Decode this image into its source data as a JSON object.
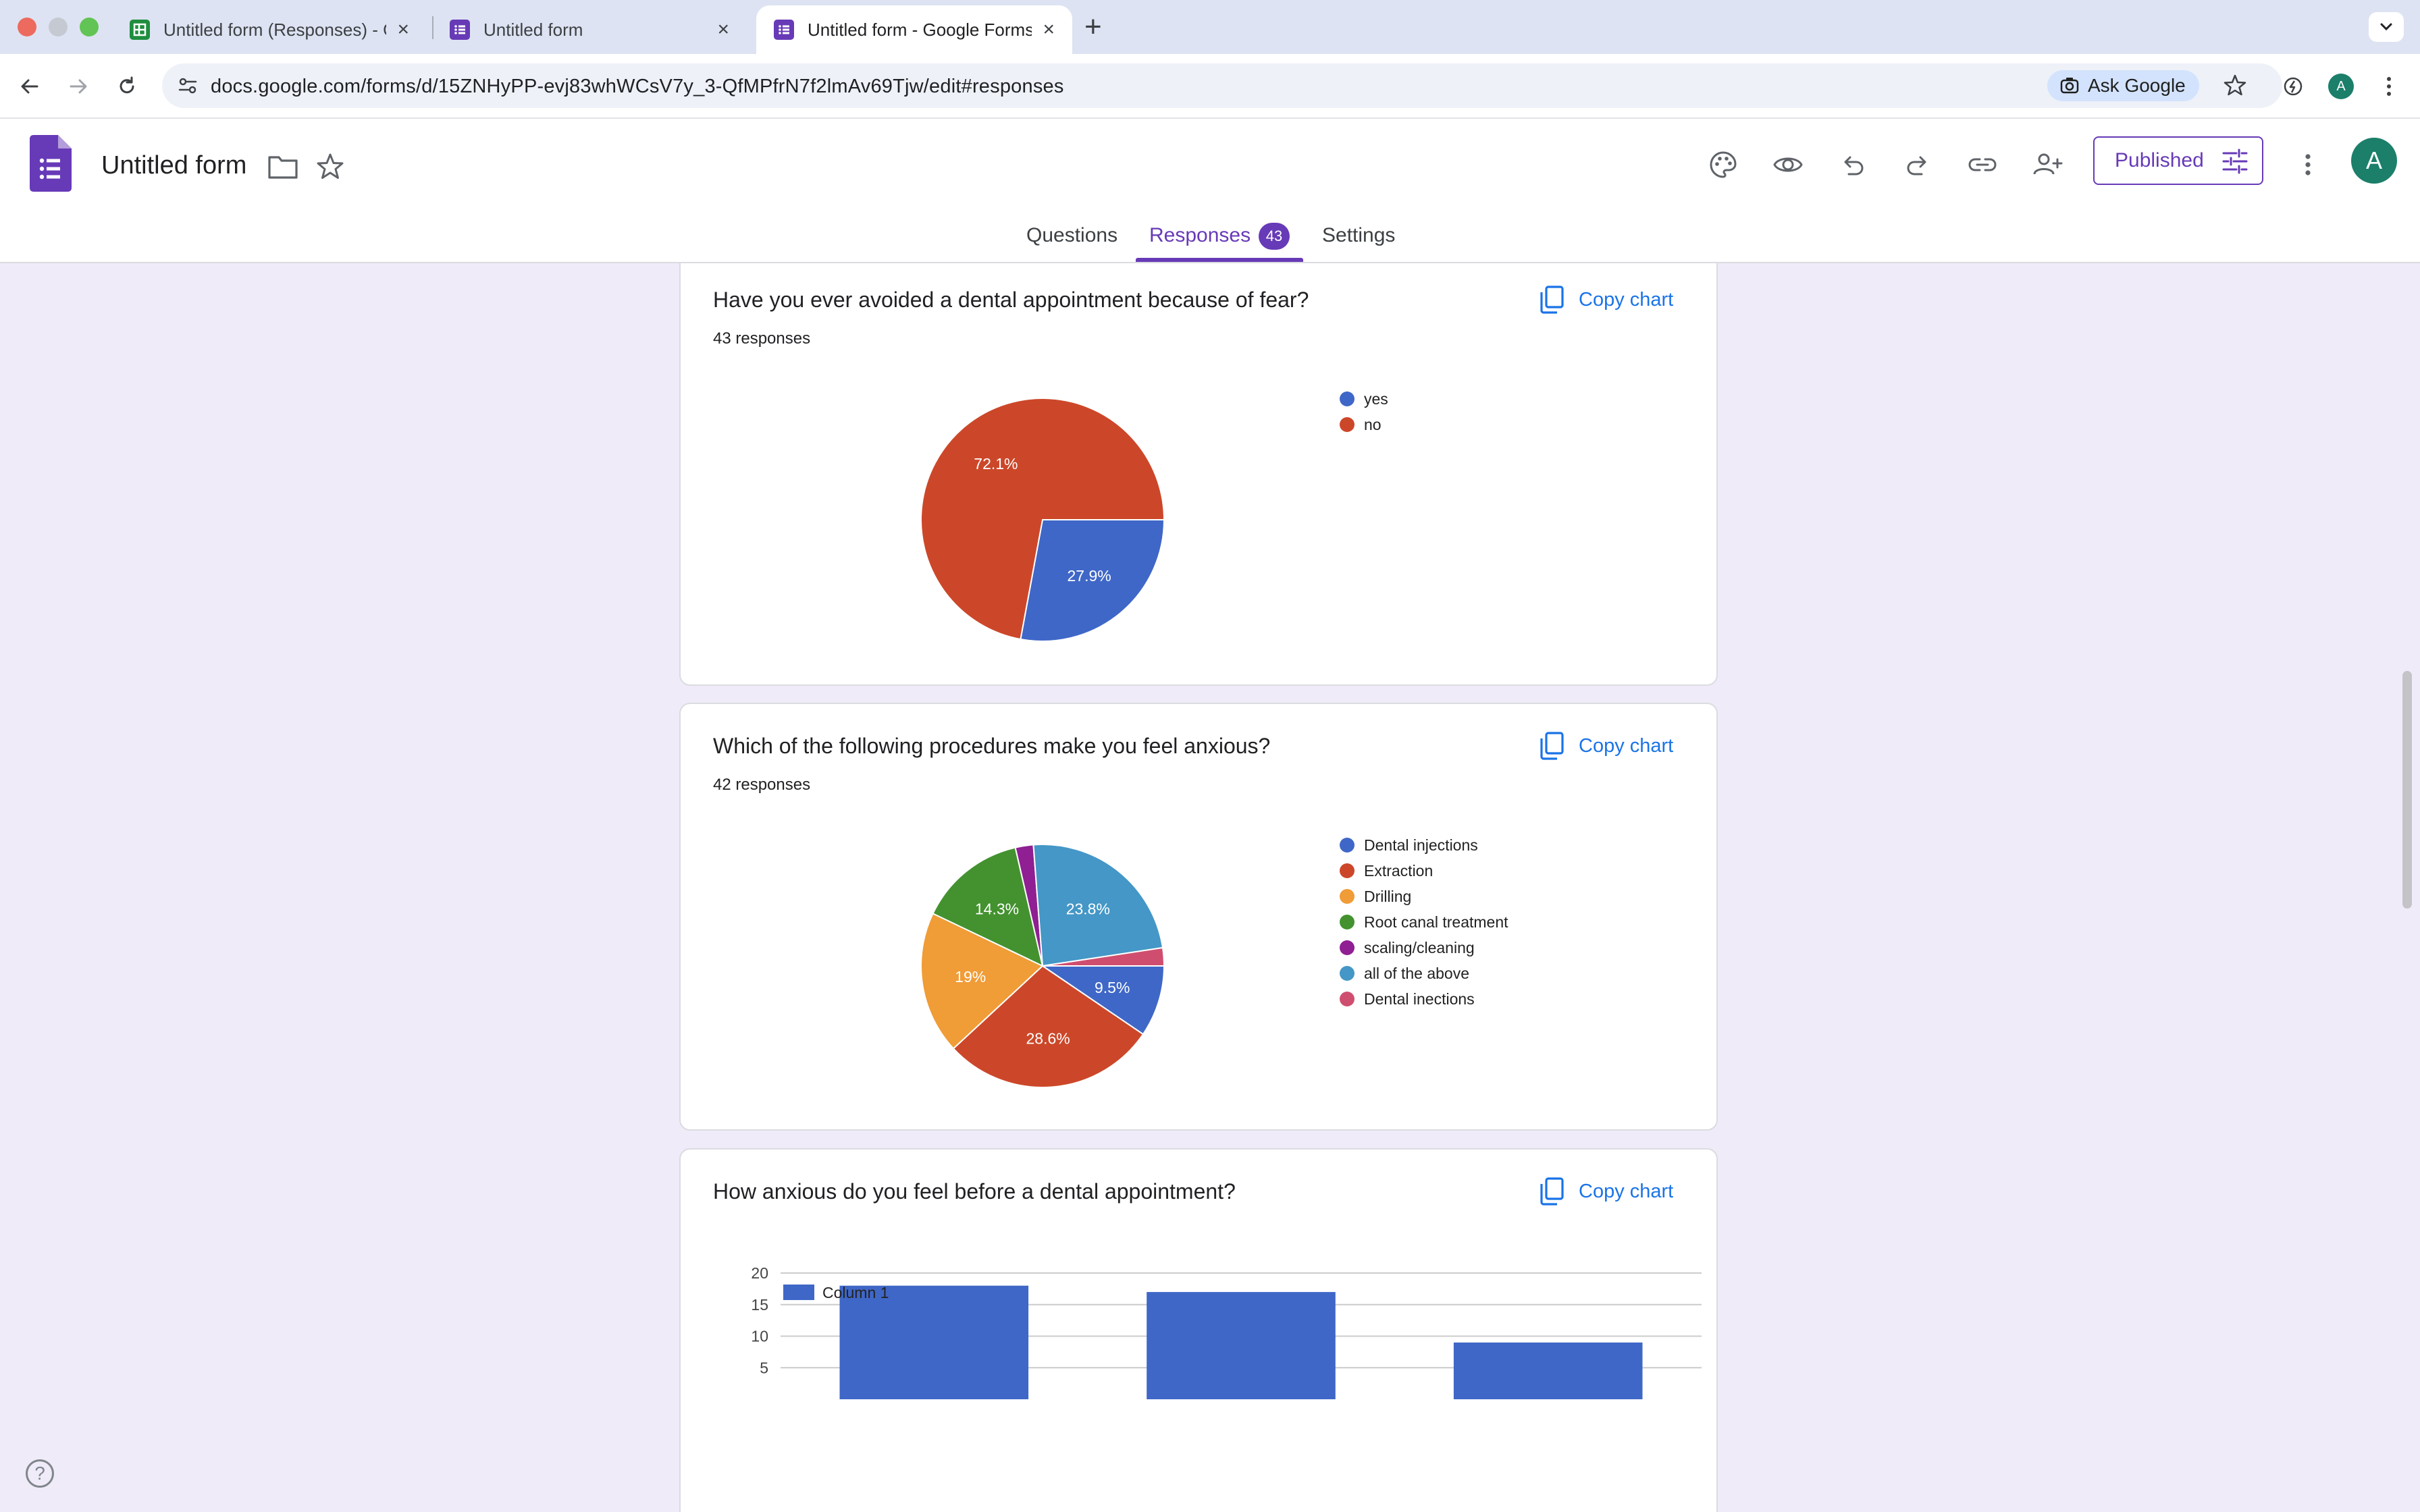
{
  "browser": {
    "tabs": [
      {
        "title": "Untitled form (Responses) - G",
        "icon": "sheets-icon",
        "active": false
      },
      {
        "title": "Untitled form",
        "icon": "forms-icon",
        "active": false
      },
      {
        "title": "Untitled form - Google Forms",
        "icon": "forms-icon",
        "active": true
      }
    ],
    "url": "docs.google.com/forms/d/15ZNHyPP-evj83whWCsV7y_3-QfMPfrN7f2lmAv69Tjw/edit#responses",
    "ask_google": "Ask Google",
    "profile_initial": "A"
  },
  "form": {
    "title": "Untitled form",
    "published_label": "Published",
    "avatar_initial": "A",
    "tabs": {
      "questions": "Questions",
      "responses": "Responses",
      "responses_count": "43",
      "settings": "Settings"
    }
  },
  "colors": {
    "accent": "#673ab7",
    "link": "#1a73e8",
    "blue": "#3f67c7",
    "red": "#cc4729",
    "orange": "#f09c37",
    "green": "#43922f",
    "purple": "#8f1f92",
    "teal": "#4497c6",
    "pink": "#cf4e6f"
  },
  "cards": [
    {
      "question": "Have you ever avoided a dental appointment because of fear?",
      "responses": "43 responses",
      "copy_label": "Copy chart"
    },
    {
      "question": "Which of the following procedures make you feel anxious?",
      "responses": "42 responses",
      "copy_label": "Copy chart"
    },
    {
      "question": "How anxious do you feel before a dental appointment?",
      "copy_label": "Copy chart"
    }
  ],
  "chart_data": [
    {
      "type": "pie",
      "slices": [
        {
          "label": "yes",
          "value": 27.9,
          "color": "#3f67c7",
          "shown_label": "27.9%"
        },
        {
          "label": "no",
          "value": 72.1,
          "color": "#cc4729",
          "shown_label": "72.1%"
        }
      ],
      "legend_position": "right"
    },
    {
      "type": "pie",
      "slices": [
        {
          "label": "Dental injections",
          "value": 9.5,
          "color": "#3f67c7",
          "shown_label": "9.5%"
        },
        {
          "label": "Extraction",
          "value": 28.6,
          "color": "#cc4729",
          "shown_label": "28.6%"
        },
        {
          "label": "Drilling",
          "value": 19.0,
          "color": "#f09c37",
          "shown_label": "19%"
        },
        {
          "label": "Root canal treatment",
          "value": 14.3,
          "color": "#43922f",
          "shown_label": "14.3%"
        },
        {
          "label": "scaling/cleaning",
          "value": 2.4,
          "color": "#8f1f92",
          "shown_label": ""
        },
        {
          "label": "all of the above",
          "value": 23.8,
          "color": "#4497c6",
          "shown_label": "23.8%"
        },
        {
          "label": "Dental inections",
          "value": 2.4,
          "color": "#cf4e6f",
          "shown_label": ""
        }
      ],
      "legend_position": "right"
    },
    {
      "type": "bar",
      "series": [
        {
          "name": "Column 1",
          "values": [
            18,
            17,
            9
          ],
          "color": "#3f67c7"
        }
      ],
      "ylim": [
        0,
        20
      ],
      "yticks": [
        "5",
        "10",
        "15",
        "20"
      ],
      "legend_position": "top-left",
      "grid": true
    }
  ]
}
